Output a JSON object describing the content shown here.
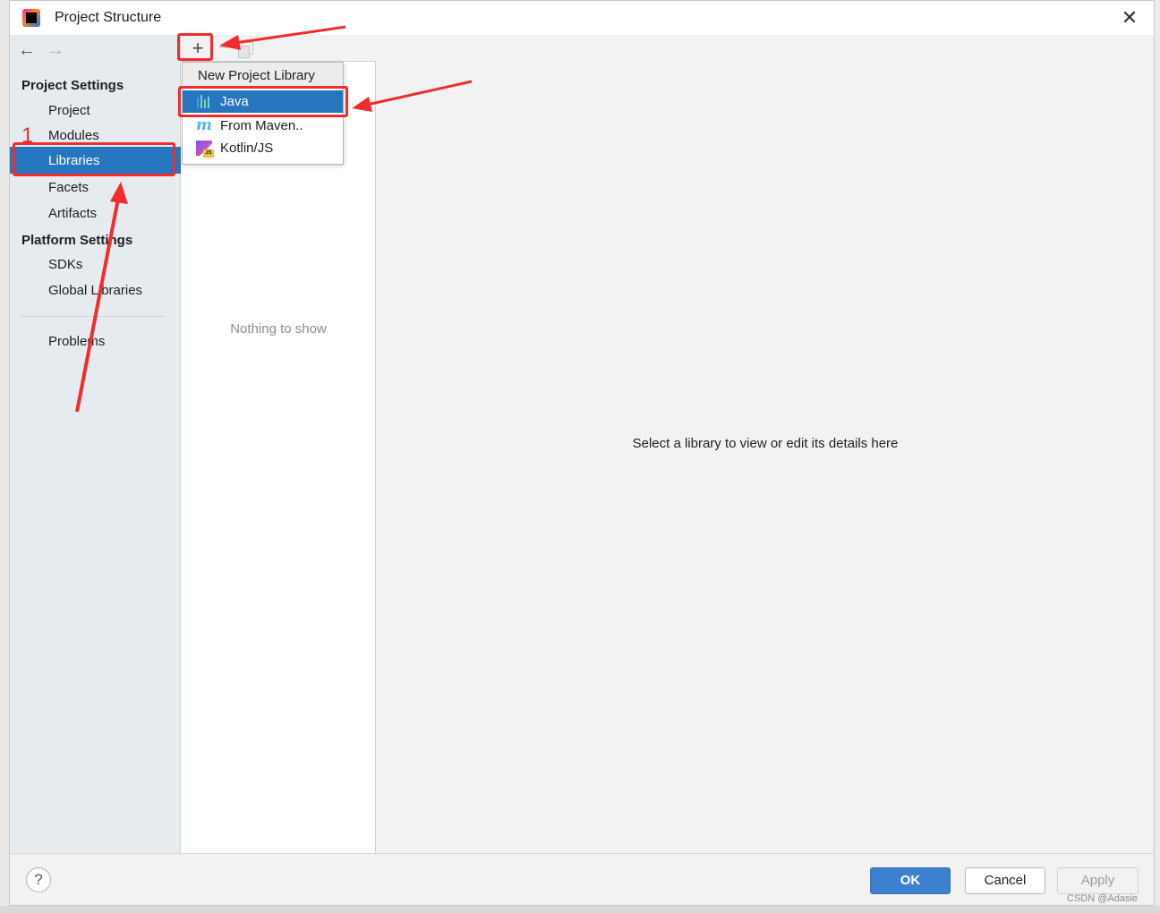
{
  "window": {
    "title": "Project Structure",
    "close_glyph": "✕"
  },
  "navigation": {
    "back_glyph": "←",
    "forward_glyph": "→"
  },
  "sidebar": {
    "project_settings_header": "Project Settings",
    "project_settings_items": [
      "Project",
      "Modules",
      "Libraries",
      "Facets",
      "Artifacts"
    ],
    "selected_item": "Libraries",
    "platform_settings_header": "Platform Settings",
    "platform_settings_items": [
      "SDKs",
      "Global Libraries"
    ],
    "problems_item": "Problems"
  },
  "toolbar": {
    "add_glyph": "+",
    "remove_glyph": "−",
    "icons": [
      "add-icon",
      "remove-icon",
      "copy-icon"
    ]
  },
  "library_list": {
    "empty_text": "Nothing to show"
  },
  "popup_menu": {
    "title": "New Project Library",
    "items": [
      {
        "label": "Java",
        "icon": "java-library-icon"
      },
      {
        "label": "From Maven..",
        "icon": "maven-icon"
      },
      {
        "label": "Kotlin/JS",
        "icon": "kotlin-js-icon"
      }
    ],
    "selected": "Java",
    "kotlin_badge": "JS"
  },
  "details": {
    "placeholder": "Select a library to view or edit its details here"
  },
  "footer": {
    "help_glyph": "?",
    "ok_label": "OK",
    "cancel_label": "Cancel",
    "apply_label": "Apply"
  },
  "annotations": {
    "step_number": "1",
    "color": "#f02c2c"
  },
  "watermark": "CSDN @Adasie",
  "colors": {
    "selection": "#2675bf",
    "ok_button": "#3d80cf",
    "sidebar_bg": "#e6ebf0",
    "dialog_bg": "#f2f2f2"
  }
}
